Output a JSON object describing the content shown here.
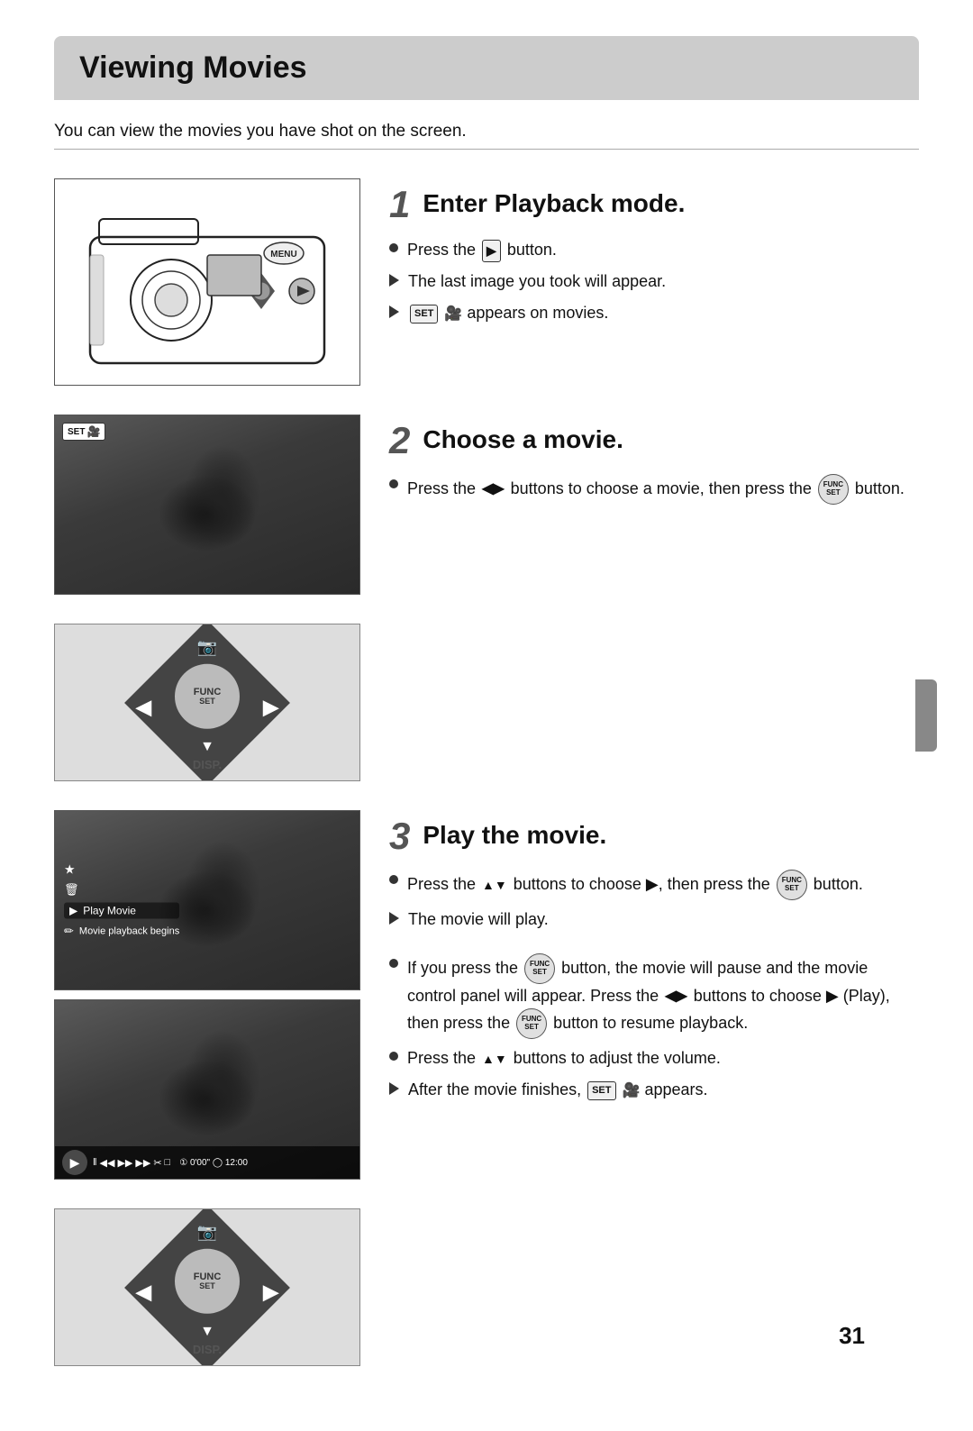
{
  "page": {
    "title": "Viewing Movies",
    "intro": "You can view the movies you have shot on the screen.",
    "page_number": "31"
  },
  "steps": [
    {
      "number": "1",
      "heading": "Enter Playback mode.",
      "bullets": [
        {
          "type": "circle",
          "text_parts": [
            "Press the",
            "PLAY_BTN",
            "button."
          ]
        },
        {
          "type": "triangle",
          "text": "The last image you took will appear."
        },
        {
          "type": "triangle",
          "text_parts": [
            "SET_BADGE",
            "MOVIE_ICON",
            "appears on movies."
          ]
        }
      ]
    },
    {
      "number": "2",
      "heading": "Choose a movie.",
      "bullets": [
        {
          "type": "circle",
          "text_parts": [
            "Press the",
            "LR_ARROWS",
            "buttons to choose a movie, then press the",
            "FUNC_SET",
            "button."
          ]
        }
      ]
    },
    {
      "number": "3",
      "heading": "Play the movie.",
      "bullets": [
        {
          "type": "circle",
          "text_parts": [
            "Press the",
            "UD_ARROWS",
            "buttons to choose",
            "PLAY_ARROW",
            ", then press the",
            "FUNC_SET",
            "button."
          ]
        },
        {
          "type": "triangle",
          "text": "The movie will play."
        }
      ]
    }
  ],
  "notes": [
    {
      "type": "circle",
      "text_parts": [
        "If you press the",
        "FUNC_SET",
        "button, the movie will pause and the movie control panel will appear. Press the",
        "LR_ARROWS",
        "buttons to choose",
        "PLAY_ARROW",
        "(Play), then press the",
        "FUNC_SET",
        "button to resume playback."
      ]
    },
    {
      "type": "circle",
      "text_parts": [
        "Press the",
        "UD_ARROWS",
        "buttons to adjust the volume."
      ]
    },
    {
      "type": "triangle",
      "text_parts": [
        "After the movie finishes,",
        "SET_BADGE",
        "MOVIE_ICON",
        "appears."
      ]
    }
  ],
  "labels": {
    "func": "FUNC",
    "set": "SET",
    "disp": "DISP.",
    "play_movie": "Play Movie",
    "movie_playback": "Movie playback begins",
    "time": "0'00\"",
    "clock": "12:00"
  }
}
